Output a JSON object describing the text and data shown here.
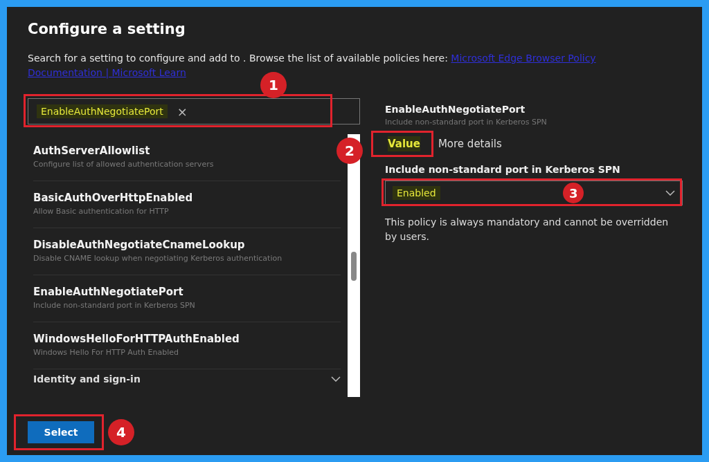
{
  "dialog": {
    "title": "Configure a setting",
    "description": "Search for a setting to configure and add to . Browse the list of available policies here: ",
    "link_lines": [
      "Microsoft Edge Browser Policy",
      "Documentation | Microsoft Learn"
    ]
  },
  "search": {
    "value": "EnableAuthNegotiatePort",
    "clear": "×"
  },
  "settings": [
    {
      "name": "AuthServerAllowlist",
      "description": "Configure list of allowed authentication servers"
    },
    {
      "name": "BasicAuthOverHttpEnabled",
      "description": "Allow Basic authentication for HTTP"
    },
    {
      "name": "DisableAuthNegotiateCnameLookup",
      "description": "Disable CNAME lookup when negotiating Kerberos authentication"
    },
    {
      "name": "EnableAuthNegotiatePort",
      "description": "Include non-standard port in Kerberos SPN"
    },
    {
      "name": "WindowsHelloForHTTPAuthEnabled",
      "description": "Windows Hello For HTTP Auth Enabled"
    }
  ],
  "category": {
    "label": "Identity and sign-in",
    "expanded": false
  },
  "detail": {
    "name": "EnableAuthNegotiatePort",
    "description": "Include non-standard port in Kerberos SPN",
    "tabs": [
      {
        "label": "Value",
        "selected": true
      },
      {
        "label": "More details",
        "selected": false
      }
    ],
    "field_label": "Include non-standard port in Kerberos SPN",
    "value": "Enabled",
    "note": "This policy is always mandatory and cannot be overridden by users."
  },
  "select_button": "Select",
  "annotations": [
    "1",
    "2",
    "3",
    "4"
  ]
}
